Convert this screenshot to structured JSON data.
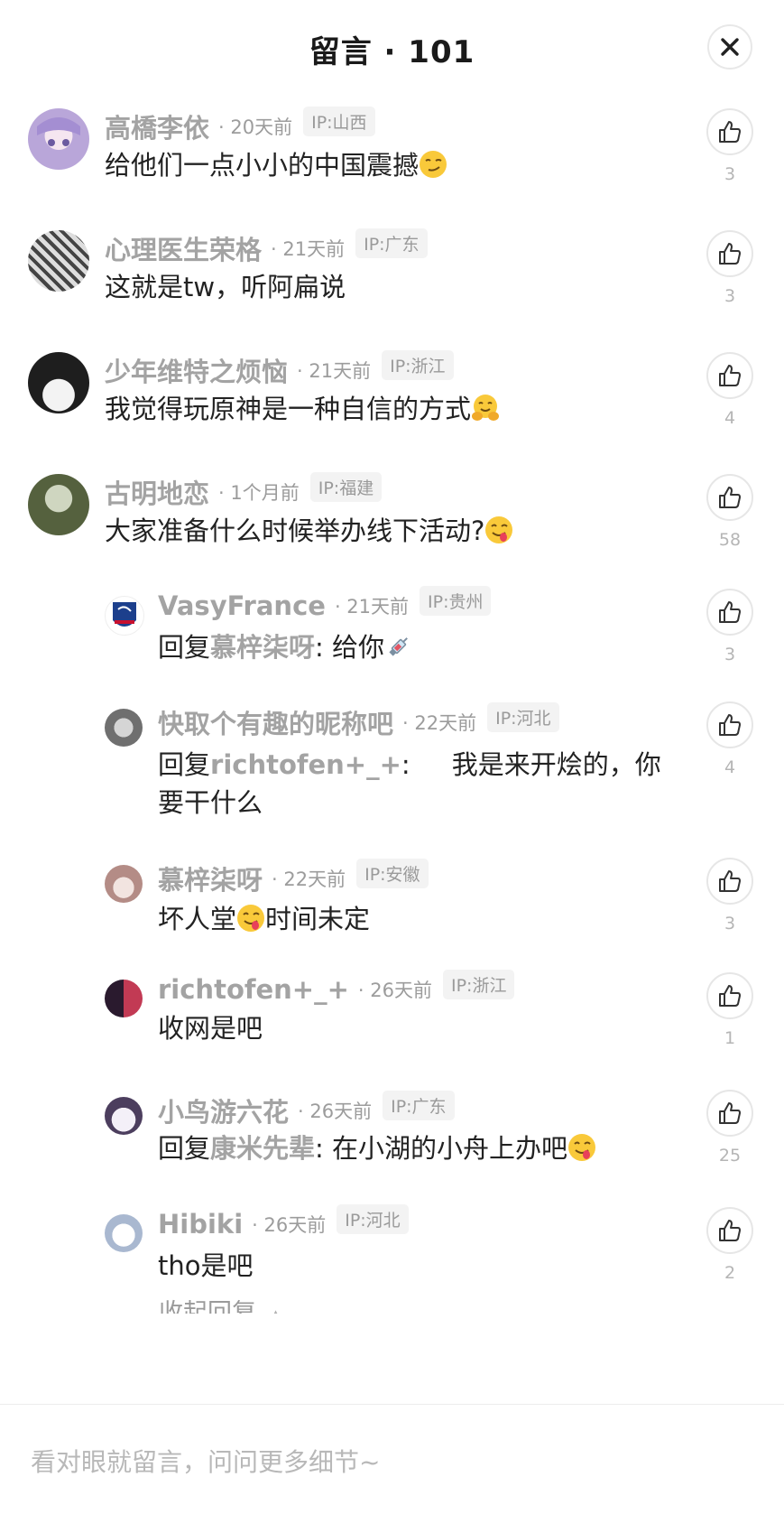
{
  "header": {
    "title": "留言 · 101"
  },
  "comments": [
    {
      "author": "高橋李依",
      "time": "· 20天前",
      "ip": "IP:山西",
      "text": "给他们一点小小的中国震撼",
      "emoji": "smirk",
      "likes": "3",
      "avatar_color": "#b9a6d9"
    },
    {
      "author": "心理医生荣格",
      "time": "· 21天前",
      "ip": "IP:广东",
      "text": "这就是tw，听阿扁说",
      "likes": "3",
      "avatar_color": "#8a8a8a"
    },
    {
      "author": "少年维特之烦恼",
      "time": "· 21天前",
      "ip": "IP:浙江",
      "text": "我觉得玩原神是一种自信的方式",
      "emoji": "hug",
      "likes": "4",
      "avatar_color": "#2b2b2b"
    },
    {
      "author": "古明地恋",
      "time": "· 1个月前",
      "ip": "IP:福建",
      "text": "大家准备什么时候举办线下活动?",
      "emoji": "yum",
      "likes": "58",
      "avatar_color": "#6e7d5a"
    }
  ],
  "replies": [
    {
      "author": "VasyFrance",
      "time": "· 21天前",
      "ip": "IP:贵州",
      "prefix": "回复",
      "mention": "慕梓柒呀",
      "text": ": 给你",
      "emoji": "syringe",
      "likes": "3",
      "avatar_color": "#1c3f8c"
    },
    {
      "author": "快取个有趣的昵称吧",
      "time": "· 22天前",
      "ip": "IP:河北",
      "prefix": "回复",
      "mention": "richtofen+_+",
      "text": ":     我是来开烩的，你要干什么",
      "likes": "4",
      "avatar_color": "#7d7d7d"
    },
    {
      "author": "慕梓柒呀",
      "time": "· 22天前",
      "ip": "IP:安徽",
      "prefix": "",
      "mention": "",
      "text_before": "坏人堂",
      "emoji": "yum",
      "text": "时间未定",
      "likes": "3",
      "avatar_color": "#c9a7a0"
    },
    {
      "author": "richtofen+_+",
      "time": "· 26天前",
      "ip": "IP:浙江",
      "prefix": "",
      "mention": "",
      "text": "收网是吧",
      "likes": "1",
      "avatar_color": "#5a3a5e"
    },
    {
      "author": "小鸟游六花",
      "time": "· 26天前",
      "ip": "IP:广东",
      "prefix": "回复",
      "mention": "康米先辈",
      "text": ": 在小湖的小舟上办吧",
      "emoji": "yum",
      "likes": "25",
      "avatar_color": "#5a4a6b"
    },
    {
      "author": "Hibiki",
      "time": "· 26天前",
      "ip": "IP:河北",
      "prefix": "",
      "mention": "",
      "text": "tho是吧",
      "likes": "2",
      "avatar_color": "#b7c4d8"
    }
  ],
  "collapse_label": "收起回复",
  "input": {
    "placeholder": "看对眼就留言，问问更多细节~"
  }
}
